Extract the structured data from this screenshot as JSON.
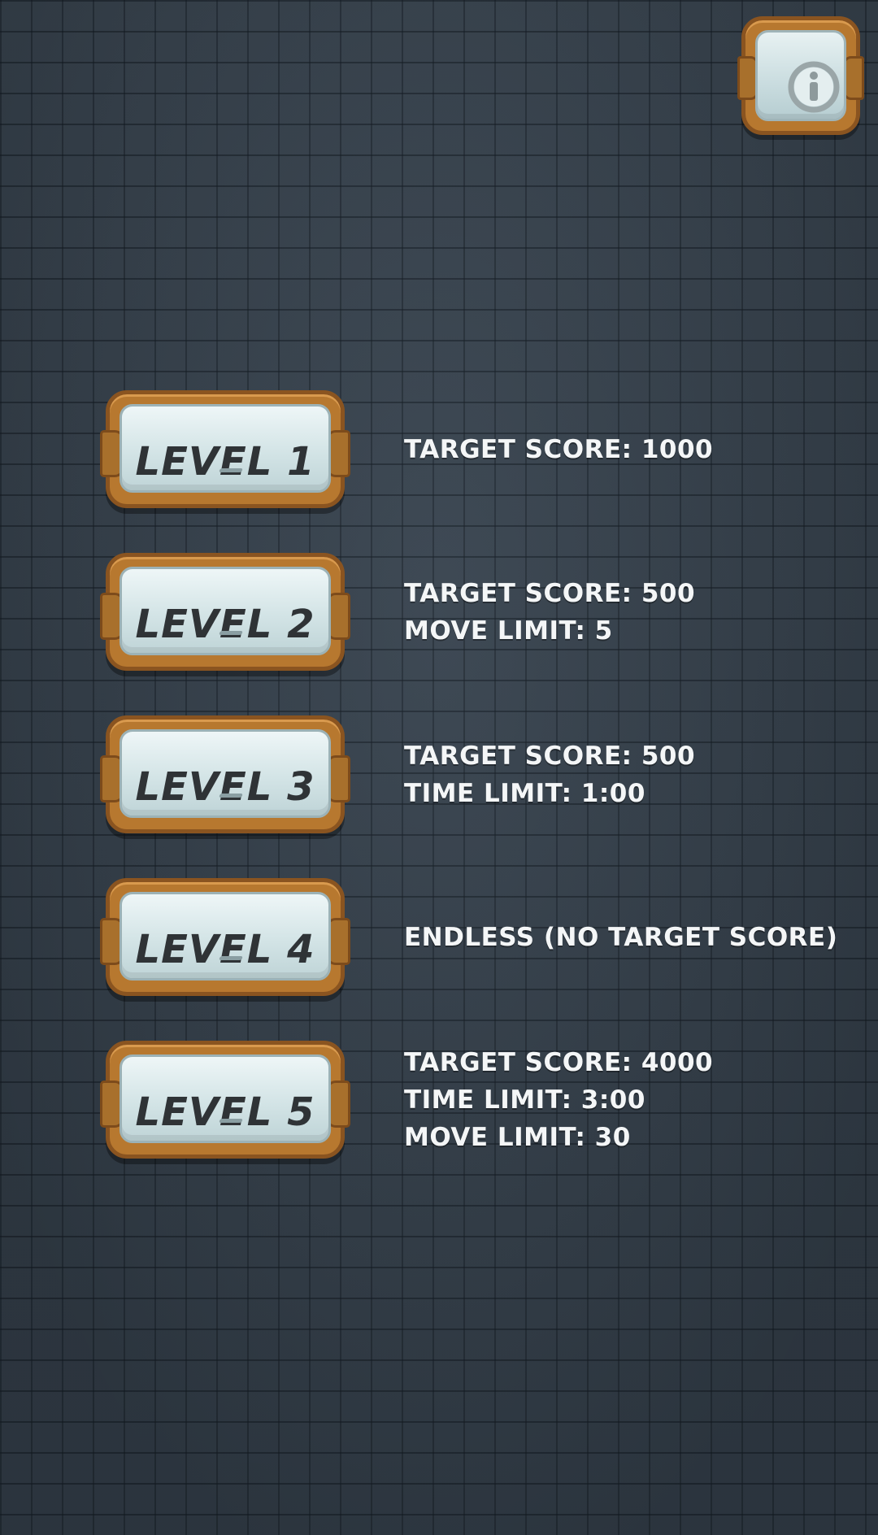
{
  "info_button": {
    "icon": "info-icon"
  },
  "levels": [
    {
      "label": "LEVEL 1",
      "info": [
        "TARGET SCORE: 1000"
      ]
    },
    {
      "label": "LEVEL 2",
      "info": [
        "TARGET SCORE: 500",
        "MOVE LIMIT: 5"
      ]
    },
    {
      "label": "LEVEL 3",
      "info": [
        "TARGET SCORE: 500",
        "TIME LIMIT: 1:00"
      ]
    },
    {
      "label": "LEVEL 4",
      "info": [
        "ENDLESS (NO TARGET SCORE)"
      ]
    },
    {
      "label": "LEVEL 5",
      "info": [
        "TARGET SCORE: 4000",
        "TIME LIMIT: 3:00",
        "MOVE LIMIT: 30"
      ]
    }
  ],
  "colors": {
    "background": "#37434f",
    "frame": "#b7782f",
    "plate": "#d3e4e6",
    "label_text": "#2f3336",
    "info_text": "#f4f6f7"
  }
}
